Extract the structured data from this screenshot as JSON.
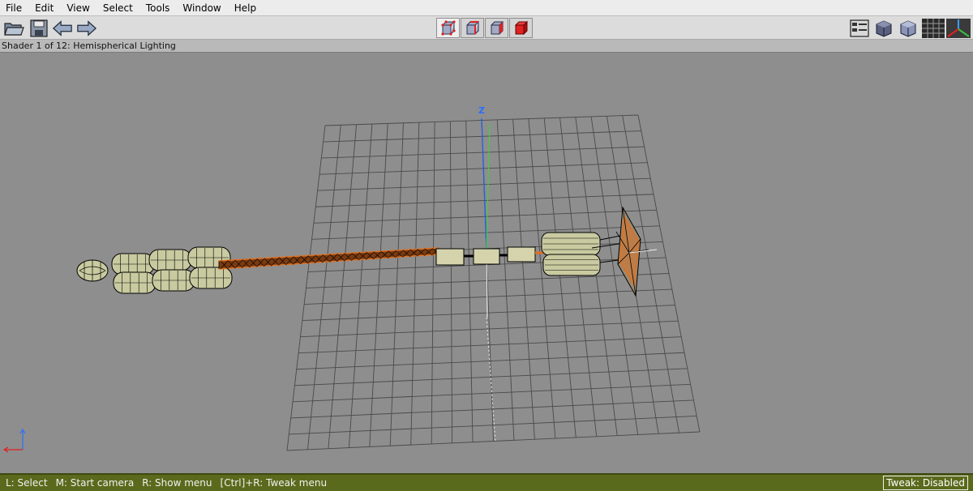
{
  "menu": {
    "items": [
      "File",
      "Edit",
      "View",
      "Select",
      "Tools",
      "Window",
      "Help"
    ]
  },
  "toolbar": {
    "left_icons": [
      "open-folder-icon",
      "save-icon",
      "arrow-left-icon",
      "arrow-right-icon"
    ],
    "mode_icons": [
      "vertex-select-icon",
      "edge-select-icon",
      "face-select-icon",
      "body-select-icon"
    ],
    "right_icons": [
      "outliner-icon",
      "smooth-shade-icon",
      "flat-shade-icon",
      "grid-toggle-icon",
      "axes-toggle-icon"
    ]
  },
  "shader": {
    "title": "Shader 1 of 12: Hemispherical Lighting"
  },
  "viewport": {
    "axis_label": "Z",
    "background": "#8e8e8e",
    "grid_color": "#4a4a4a",
    "model_wire_color": "#000000",
    "model_fill": "#c9caa0",
    "highlight_color": "#e07020"
  },
  "status": {
    "items": [
      "L: Select",
      "M: Start camera",
      "R: Show menu",
      "[Ctrl]+R: Tweak menu"
    ],
    "tweak": "Tweak: Disabled"
  },
  "colors": {
    "statusbar": "#5a6a1c",
    "menubar": "#ececec",
    "toolbar": "#dcdcdc"
  }
}
